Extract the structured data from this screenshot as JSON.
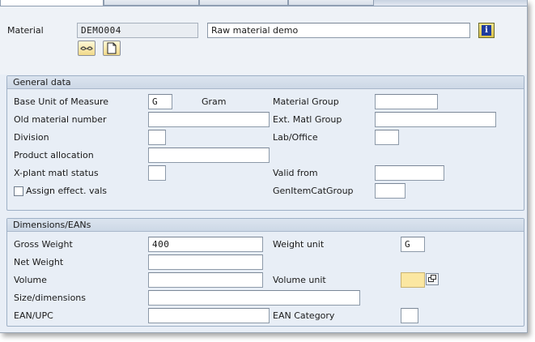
{
  "header": {
    "material_label": "Material",
    "material_value": "DEMO004",
    "description_value": "Raw material demo",
    "info_icon": "info-icon",
    "glasses_icon": "glasses-icon",
    "document_icon": "document-icon"
  },
  "general": {
    "title": "General data",
    "base_uom_label": "Base Unit of Measure",
    "base_uom_value": "G",
    "base_uom_text": "Gram",
    "material_group_label": "Material Group",
    "material_group_value": "",
    "old_matnr_label": "Old material number",
    "old_matnr_value": "",
    "ext_group_label": "Ext. Matl Group",
    "ext_group_value": "",
    "division_label": "Division",
    "division_value": "",
    "lab_office_label": "Lab/Office",
    "lab_office_value": "",
    "prod_alloc_label": "Product allocation",
    "prod_alloc_value": "",
    "xplant_label": "X-plant matl status",
    "xplant_value": "",
    "valid_from_label": "Valid from",
    "valid_from_value": "",
    "assign_label": "Assign effect. vals",
    "assign_checked": false,
    "genitem_label": "GenItemCatGroup",
    "genitem_value": ""
  },
  "dimensions": {
    "title": "Dimensions/EANs",
    "gross_weight_label": "Gross Weight",
    "gross_weight_value": "400",
    "weight_unit_label": "Weight unit",
    "weight_unit_value": "G",
    "net_weight_label": "Net Weight",
    "net_weight_value": "",
    "volume_label": "Volume",
    "volume_value": "",
    "volume_unit_label": "Volume unit",
    "volume_unit_value": "",
    "size_label": "Size/dimensions",
    "size_value": "",
    "ean_label": "EAN/UPC",
    "ean_value": "",
    "ean_cat_label": "EAN Category",
    "ean_cat_value": ""
  },
  "colors": {
    "focus_field": "#fbe7a1",
    "panel_bg": "#e8eef6"
  }
}
